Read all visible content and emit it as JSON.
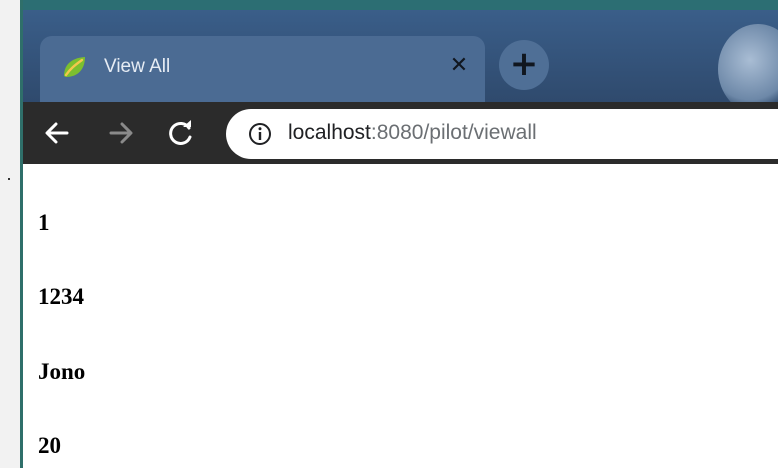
{
  "browser": {
    "tab": {
      "title": "View All",
      "favicon": "spring-leaf-icon",
      "close_icon": "close-icon"
    },
    "new_tab_icon": "plus-icon",
    "toolbar": {
      "back_icon": "arrow-left-icon",
      "forward_icon": "arrow-right-icon",
      "reload_icon": "reload-icon",
      "info_icon": "info-icon",
      "url_host": "localhost",
      "url_rest": ":8080/pilot/viewall"
    }
  },
  "page": {
    "items": [
      "1",
      "1234",
      "Jono",
      "20"
    ]
  },
  "colors": {
    "tab_strip": "#34537a",
    "active_tab": "#4b6b93",
    "toolbar": "#2b2b2b",
    "favicon_green": "#7cbf2f"
  }
}
